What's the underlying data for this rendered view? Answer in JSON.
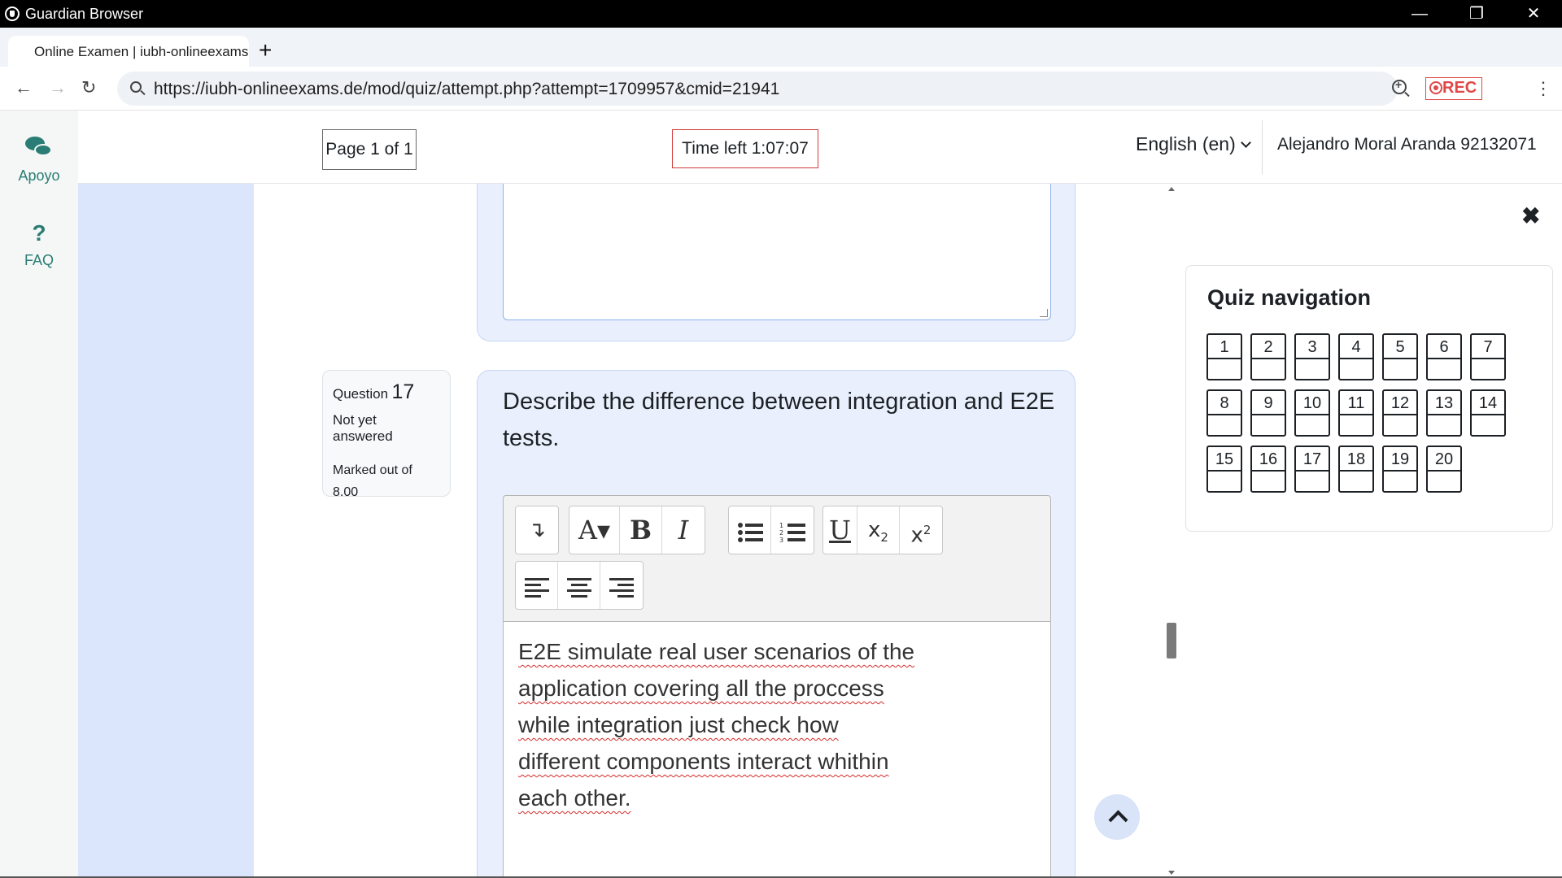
{
  "window": {
    "title": "Guardian Browser",
    "controls": {
      "minimize": "—",
      "restore": "❐",
      "close": "✕"
    }
  },
  "tabs": [
    {
      "label": "Online Examen | iubh-onlineexams.d"
    }
  ],
  "new_tab_label": "+",
  "toolbar": {
    "back": "←",
    "forward": "→",
    "reload": "↻",
    "url": "https://iubh-onlineexams.de/mod/quiz/attempt.php?attempt=1709957&cmid=21941",
    "rec_label": "REC",
    "menu": "⋮"
  },
  "rail": {
    "apoyo_label": "Apoyo",
    "faq_label": "FAQ",
    "faq_icon_glyph": "?"
  },
  "header": {
    "page_indicator": "Page 1 of 1",
    "time_left": "Time left 1:07:07",
    "language": "English (en)",
    "user": "Alejandro Moral Aranda 92132071"
  },
  "question": {
    "label": "Question",
    "number": "17",
    "state": "Not yet answered",
    "marks_label": "Marked out of",
    "marks_value": "8.00",
    "text": "Describe the difference between integration and E2E tests.",
    "answer": "E2E simulate real user scenarios of the application covering all the proccess while integration just check how different components interact whithin each other."
  },
  "editor_toolbar": {
    "collapse": "↴",
    "font": "A▾",
    "bold": "B",
    "italic": "I",
    "underline": "U",
    "subscript": "x",
    "subscript_mark": "2",
    "superscript": "x",
    "superscript_mark": "2"
  },
  "quiz_navigation": {
    "title": "Quiz navigation",
    "close_glyph": "✖",
    "questions": [
      "1",
      "2",
      "3",
      "4",
      "5",
      "6",
      "7",
      "8",
      "9",
      "10",
      "11",
      "12",
      "13",
      "14",
      "15",
      "16",
      "17",
      "18",
      "19",
      "20"
    ]
  },
  "icons": {
    "app": "shield-icon",
    "apoyo": "chat-bubbles-icon",
    "faq": "question-icon",
    "scroll_top": "chevron-up-icon"
  },
  "colors": {
    "accent_teal": "#2a7d74",
    "timer_border": "#d23c3c",
    "rec_red": "#e04848",
    "content_background": "#dbe6fc",
    "question_card": "#e9effc"
  }
}
